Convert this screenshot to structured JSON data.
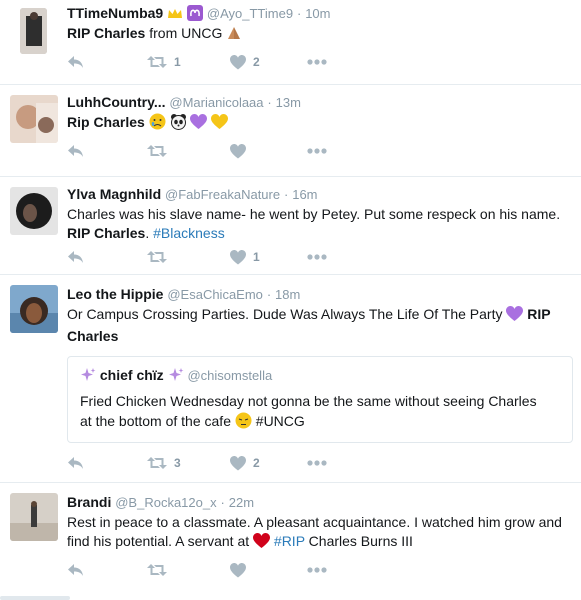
{
  "tweets": [
    {
      "name": "TTimeNumba9",
      "handle": "@Ayo_TTime9",
      "sep": "·",
      "time": "10m",
      "text_bold": "RIP Charles",
      "text_rest": " from UNCG",
      "reply_count": "",
      "retweet_count": "1",
      "like_count": "2",
      "avatar_color": "#3a3a3a"
    },
    {
      "name": "LuhhCountry...",
      "handle": "@Marianicolaaa",
      "sep": "·",
      "time": "13m",
      "text_bold": "Rip Charles",
      "retweet_count": "",
      "like_count": "",
      "avatar_color": "#d9b8a8"
    },
    {
      "name": "Ylva Magnhild",
      "handle": "@FabFreakaNature",
      "sep": "·",
      "time": "16m",
      "text_line1": "Charles was his slave name- he went by Petey. Put some respeck on his name.",
      "text_bold": "RIP Charles",
      "text_mid": ". ",
      "hashtag": "#Blackness",
      "retweet_count": "",
      "like_count": "1",
      "avatar_color": "#2a2a2a"
    },
    {
      "name": "Leo the Hippie",
      "handle": "@EsaChicaEmo",
      "sep": "·",
      "time": "18m",
      "text_line1": "Or Campus Crossing Parties. Dude Was Always The Life Of The Party",
      "text_bold1": "RIP",
      "text_bold2": "Charles",
      "quote": {
        "name": "chief chïz",
        "handle": "@chisomstella",
        "text_line1": "Fried Chicken Wednesday not gonna be the same without seeing Charles",
        "text_line2": "at the bottom of the cafe",
        "hashtag": "#UNCG"
      },
      "retweet_count": "3",
      "like_count": "2",
      "avatar_color": "#6a8fb3"
    },
    {
      "name": "Brandi",
      "handle": "@B_Rocka12o_x",
      "sep": "·",
      "time": "22m",
      "text_line1": "Rest in peace to a classmate. A pleasant acquaintance. I watched him grow and",
      "text_line2a": "find his potential.  A servant at",
      "hashtag": "#RIP",
      "text_line2b": " Charles Burns III",
      "retweet_count": "",
      "like_count": "",
      "avatar_color": "#b8b0a4"
    }
  ],
  "colors": {
    "name": "#14171a",
    "meta": "#8899a6",
    "icon": "#aab8c2",
    "link": "#2b7bb9",
    "divider": "#e6ecf0",
    "heart_purple": "#a970e0",
    "heart_yellow": "#f5c518",
    "heart_red": "#d0021b"
  },
  "icons": [
    "reply-icon",
    "retweet-icon",
    "like-icon",
    "more-icon"
  ]
}
